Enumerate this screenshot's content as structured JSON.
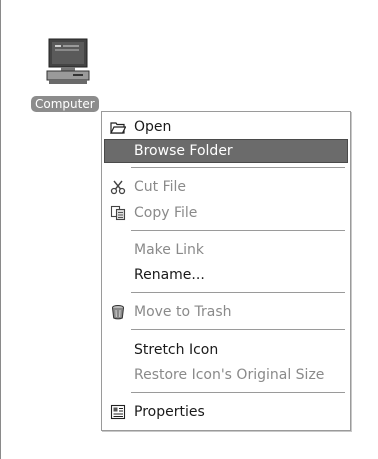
{
  "desktop": {
    "icon": {
      "name": "computer-icon",
      "label": "Computer"
    }
  },
  "context_menu": {
    "items": [
      {
        "label": "Open",
        "icon": "folder-open-icon",
        "state": "enabled"
      },
      {
        "label": "Browse Folder",
        "icon": "",
        "state": "highlighted"
      },
      {
        "label": "Cut File",
        "icon": "scissors-icon",
        "state": "disabled"
      },
      {
        "label": "Copy File",
        "icon": "copy-icon",
        "state": "disabled"
      },
      {
        "label": "Make Link",
        "icon": "",
        "state": "disabled"
      },
      {
        "label": "Rename...",
        "icon": "",
        "state": "enabled"
      },
      {
        "label": "Move to Trash",
        "icon": "trash-icon",
        "state": "disabled"
      },
      {
        "label": "Stretch Icon",
        "icon": "",
        "state": "enabled"
      },
      {
        "label": "Restore Icon's Original Size",
        "icon": "",
        "state": "disabled"
      },
      {
        "label": "Properties",
        "icon": "properties-icon",
        "state": "enabled"
      }
    ]
  },
  "colors": {
    "highlight": "#6b6b6b",
    "disabled_text": "#8a8a8a",
    "label_background": "#8c8c8c"
  }
}
